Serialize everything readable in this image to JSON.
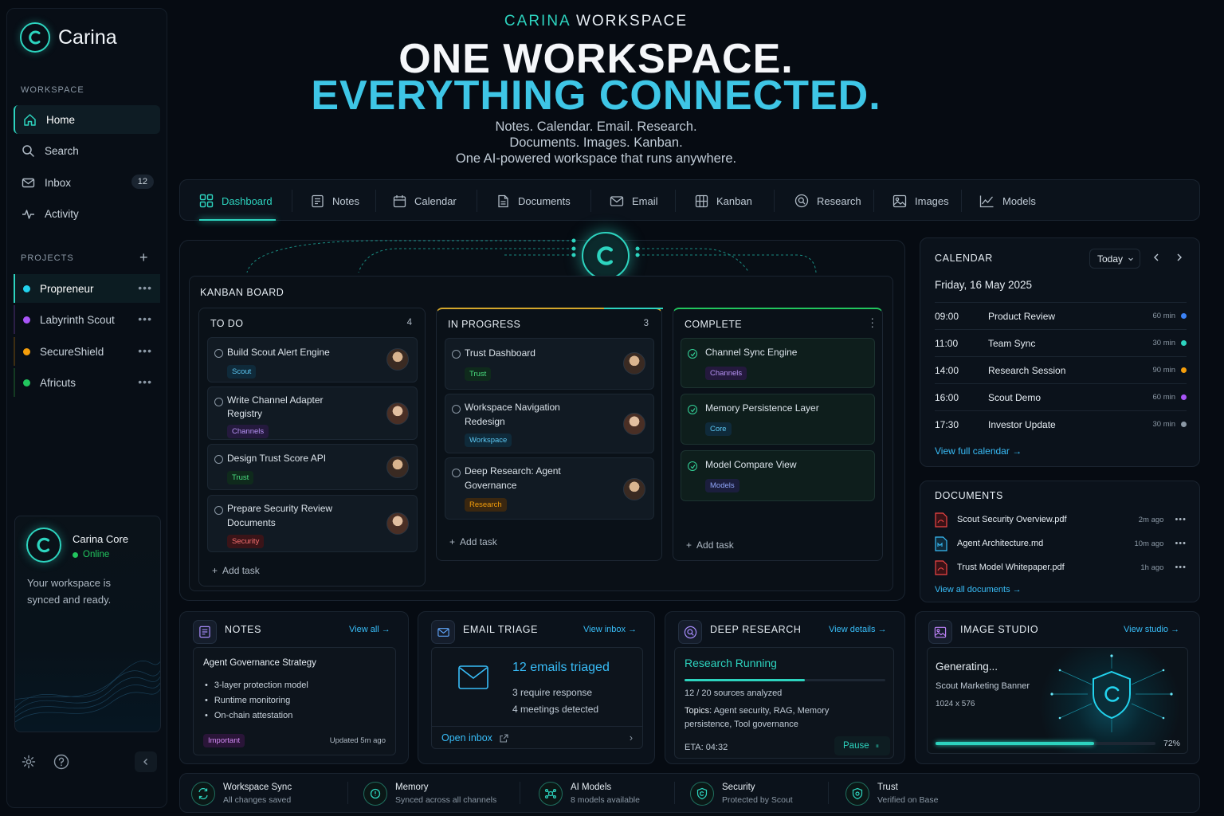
{
  "app": {
    "name": "Carina"
  },
  "colors": {
    "accent": "#2dd4bf",
    "link": "#38bdf8",
    "purple": "#a855f7",
    "orange": "#f59e0b",
    "green": "#22c55e"
  },
  "sidebar": {
    "workspace_label": "WORKSPACE",
    "nav": [
      {
        "label": "Home",
        "icon": "home-icon",
        "active": true
      },
      {
        "label": "Search",
        "icon": "search-icon"
      },
      {
        "label": "Inbox",
        "icon": "inbox-icon",
        "badge": "12"
      },
      {
        "label": "Activity",
        "icon": "activity-icon"
      }
    ],
    "projects_label": "PROJECTS",
    "projects": [
      {
        "label": "Propreneur",
        "color": "#22d3ee",
        "active": true
      },
      {
        "label": "Labyrinth Scout",
        "color": "#a855f7"
      },
      {
        "label": "SecureShield",
        "color": "#f59e0b"
      },
      {
        "label": "Africuts",
        "color": "#22c55e"
      }
    ],
    "core": {
      "name": "Carina Core",
      "status": "Online",
      "message_1": "Your workspace is",
      "message_2": "synced and ready."
    }
  },
  "hero": {
    "kicker_a": "CARINA",
    "kicker_b": "WORKSPACE",
    "line1": "ONE WORKSPACE.",
    "line2": "EVERYTHING CONNECTED.",
    "sub1": "Notes. Calendar. Email. Research.",
    "sub2": "Documents. Images. Kanban.",
    "sub3": "One AI-powered workspace that runs anywhere."
  },
  "tabs": [
    {
      "label": "Dashboard",
      "icon": "dashboard-icon",
      "active": true
    },
    {
      "label": "Notes",
      "icon": "notes-icon"
    },
    {
      "label": "Calendar",
      "icon": "calendar-icon"
    },
    {
      "label": "Documents",
      "icon": "document-icon"
    },
    {
      "label": "Email",
      "icon": "mail-icon"
    },
    {
      "label": "Kanban",
      "icon": "kanban-icon"
    },
    {
      "label": "Research",
      "icon": "research-icon"
    },
    {
      "label": "Images",
      "icon": "image-icon"
    },
    {
      "label": "Models",
      "icon": "chart-icon"
    }
  ],
  "kanban": {
    "title": "KANBAN BOARD",
    "todo": {
      "label": "TO DO",
      "count": "4"
    },
    "progress": {
      "label": "IN PROGRESS",
      "count": "3"
    },
    "complete": {
      "label": "COMPLETE"
    },
    "add_task": "Add task",
    "cards": {
      "t1": {
        "title": "Build Scout Alert Engine",
        "tag": "Scout"
      },
      "t2": {
        "title1": "Write Channel Adapter",
        "title2": "Registry",
        "tag": "Channels"
      },
      "t3": {
        "title": "Design Trust Score API",
        "tag": "Trust"
      },
      "t4": {
        "title1": "Prepare Security Review",
        "title2": "Documents",
        "tag": "Security"
      },
      "p1": {
        "title": "Trust Dashboard",
        "tag": "Trust"
      },
      "p2": {
        "title1": "Workspace Navigation",
        "title2": "Redesign",
        "tag": "Workspace"
      },
      "p3": {
        "title1": "Deep Research: Agent",
        "title2": "Governance",
        "tag": "Research"
      },
      "c1": {
        "title": "Channel Sync Engine",
        "tag": "Channels"
      },
      "c2": {
        "title": "Memory Persistence Layer",
        "tag": "Core"
      },
      "c3": {
        "title": "Model Compare View",
        "tag": "Models"
      }
    }
  },
  "calendar": {
    "title": "CALENDAR",
    "today_btn": "Today",
    "date": "Friday, 16 May 2025",
    "events": [
      {
        "time": "09:00",
        "name": "Product Review",
        "dur": "60 min",
        "color": "#3b82f6"
      },
      {
        "time": "11:00",
        "name": "Team Sync",
        "dur": "30 min",
        "color": "#2dd4bf"
      },
      {
        "time": "14:00",
        "name": "Research Session",
        "dur": "90 min",
        "color": "#f59e0b"
      },
      {
        "time": "16:00",
        "name": "Scout Demo",
        "dur": "60 min",
        "color": "#a855f7"
      },
      {
        "time": "17:30",
        "name": "Investor Update",
        "dur": "30 min",
        "color": "#8b98a5"
      }
    ],
    "view_all": "View full calendar"
  },
  "documents": {
    "title": "DOCUMENTS",
    "items": [
      {
        "name": "Scout Security Overview.pdf",
        "age": "2m ago",
        "type": "pdf"
      },
      {
        "name": "Agent Architecture.md",
        "age": "10m ago",
        "type": "md"
      },
      {
        "name": "Trust Model Whitepaper.pdf",
        "age": "1h ago",
        "type": "pdf"
      }
    ],
    "view_all": "View all documents"
  },
  "notes": {
    "title": "NOTES",
    "link": "View all",
    "note_title": "Agent Governance Strategy",
    "bullets": [
      "3-layer protection model",
      "Runtime monitoring",
      "On-chain attestation"
    ],
    "tag": "Important",
    "updated": "Updated 5m ago"
  },
  "email": {
    "title": "EMAIL TRIAGE",
    "link": "View inbox",
    "headline": "12 emails triaged",
    "line1": "3 require response",
    "line2": "4 meetings detected",
    "open": "Open inbox"
  },
  "research": {
    "title": "DEEP RESEARCH",
    "link": "View details",
    "status": "Research Running",
    "progress": 0.6,
    "sources": "12 / 20 sources analyzed",
    "topics_label": "Topics:",
    "topics_1": "Agent security, RAG, Memory",
    "topics_2": "persistence, Tool governance",
    "eta": "ETA: 04:32",
    "pause": "Pause"
  },
  "image_studio": {
    "title": "IMAGE STUDIO",
    "link": "View studio",
    "status": "Generating...",
    "name": "Scout Marketing Banner",
    "size": "1024 x 576",
    "progress": 0.72,
    "progress_label": "72%"
  },
  "status": [
    {
      "title": "Workspace Sync",
      "sub": "All changes saved",
      "icon": "sync-icon"
    },
    {
      "title": "Memory",
      "sub": "Synced across all channels",
      "icon": "memory-icon"
    },
    {
      "title": "AI Models",
      "sub": "8 models available",
      "icon": "ai-models-icon"
    },
    {
      "title": "Security",
      "sub": "Protected by Scout",
      "icon": "shield-icon"
    },
    {
      "title": "Trust",
      "sub": "Verified on Base",
      "icon": "trust-icon"
    }
  ]
}
